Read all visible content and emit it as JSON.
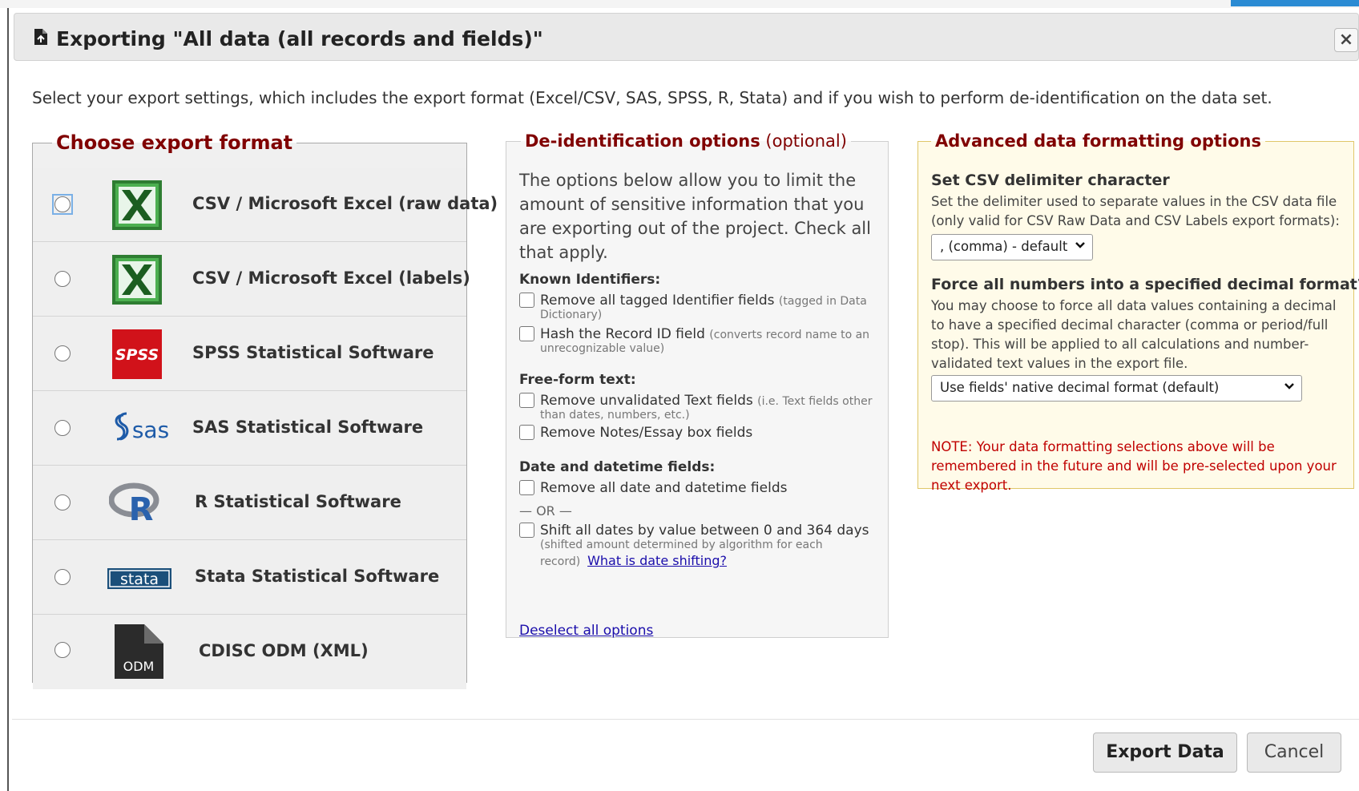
{
  "dialog": {
    "title": "Exporting \"All data (all records and fields)\"",
    "close_label": "×",
    "intro": "Select your export settings, which includes the export format (Excel/CSV, SAS, SPSS, R, Stata) and if you wish to perform de-identification on the data set."
  },
  "export_format": {
    "legend": "Choose export format",
    "options": [
      {
        "label": "CSV / Microsoft Excel (raw data)",
        "icon": "excel-icon"
      },
      {
        "label": "CSV / Microsoft Excel (labels)",
        "icon": "excel-icon"
      },
      {
        "label": "SPSS Statistical Software",
        "icon": "spss-icon",
        "logo_text": "SPSS"
      },
      {
        "label": "SAS Statistical Software",
        "icon": "sas-icon",
        "logo_text": "sas"
      },
      {
        "label": "R Statistical Software",
        "icon": "r-icon",
        "logo_text": "R"
      },
      {
        "label": "Stata Statistical Software",
        "icon": "stata-icon",
        "logo_text": "stata"
      },
      {
        "label": "CDISC ODM (XML)",
        "icon": "odm-file-icon",
        "logo_text": "ODM"
      }
    ]
  },
  "deid": {
    "legend_bold": "De-identification options",
    "legend_rest": "(optional)",
    "intro": "The options below allow you to limit the amount of sensitive information that you are exporting out of the project. Check all that apply.",
    "known_identifiers": {
      "heading": "Known Identifiers:",
      "remove_tagged": "Remove all tagged Identifier fields",
      "remove_tagged_note": "(tagged in Data",
      "remove_tagged_note2": "Dictionary)",
      "hash_record": "Hash the Record ID field",
      "hash_record_note": "(converts record name to an",
      "hash_record_note2": "unrecognizable value)"
    },
    "free_form": {
      "heading": "Free-form text:",
      "remove_unvalidated": "Remove unvalidated Text fields",
      "remove_unvalidated_note": "(i.e. Text fields other",
      "remove_unvalidated_note2": "than dates, numbers, etc.)",
      "remove_notes": "Remove Notes/Essay box fields"
    },
    "dates": {
      "heading": "Date and datetime fields:",
      "remove_dates": "Remove all date and datetime fields",
      "or": "— OR —",
      "shift_dates": "Shift all dates by value between 0 and 364 days",
      "shift_note": "(shifted amount determined by algorithm for each",
      "shift_note2": "record)",
      "shift_link": "What is date shifting?"
    },
    "deselect_all": "Deselect all options"
  },
  "advanced": {
    "legend": "Advanced data formatting options",
    "delimiter_heading": "Set CSV delimiter character",
    "delimiter_desc": "Set the delimiter used to separate values in the CSV data file (only valid for CSV Raw Data and CSV Labels export formats):",
    "delimiter_value": ", (comma) - default",
    "decimal_heading": "Force all numbers into a specified decimal format?",
    "decimal_desc": "You may choose to force all data values containing a decimal to have a specified decimal character (comma or period/full stop). This will be applied to all calculations and number-validated text values in the export file.",
    "decimal_value": "Use fields' native decimal format (default)",
    "note": "NOTE: Your data formatting selections above will be remembered in the future and will be pre-selected upon your next export."
  },
  "footer": {
    "export_label": "Export Data",
    "cancel_label": "Cancel"
  },
  "colors": {
    "legend": "#800000",
    "note": "#c00000",
    "accent": "#2b8bd3",
    "excel_green": "#2e7d32",
    "spss_red": "#d1121a",
    "stata_blue": "#1b4f7a"
  }
}
